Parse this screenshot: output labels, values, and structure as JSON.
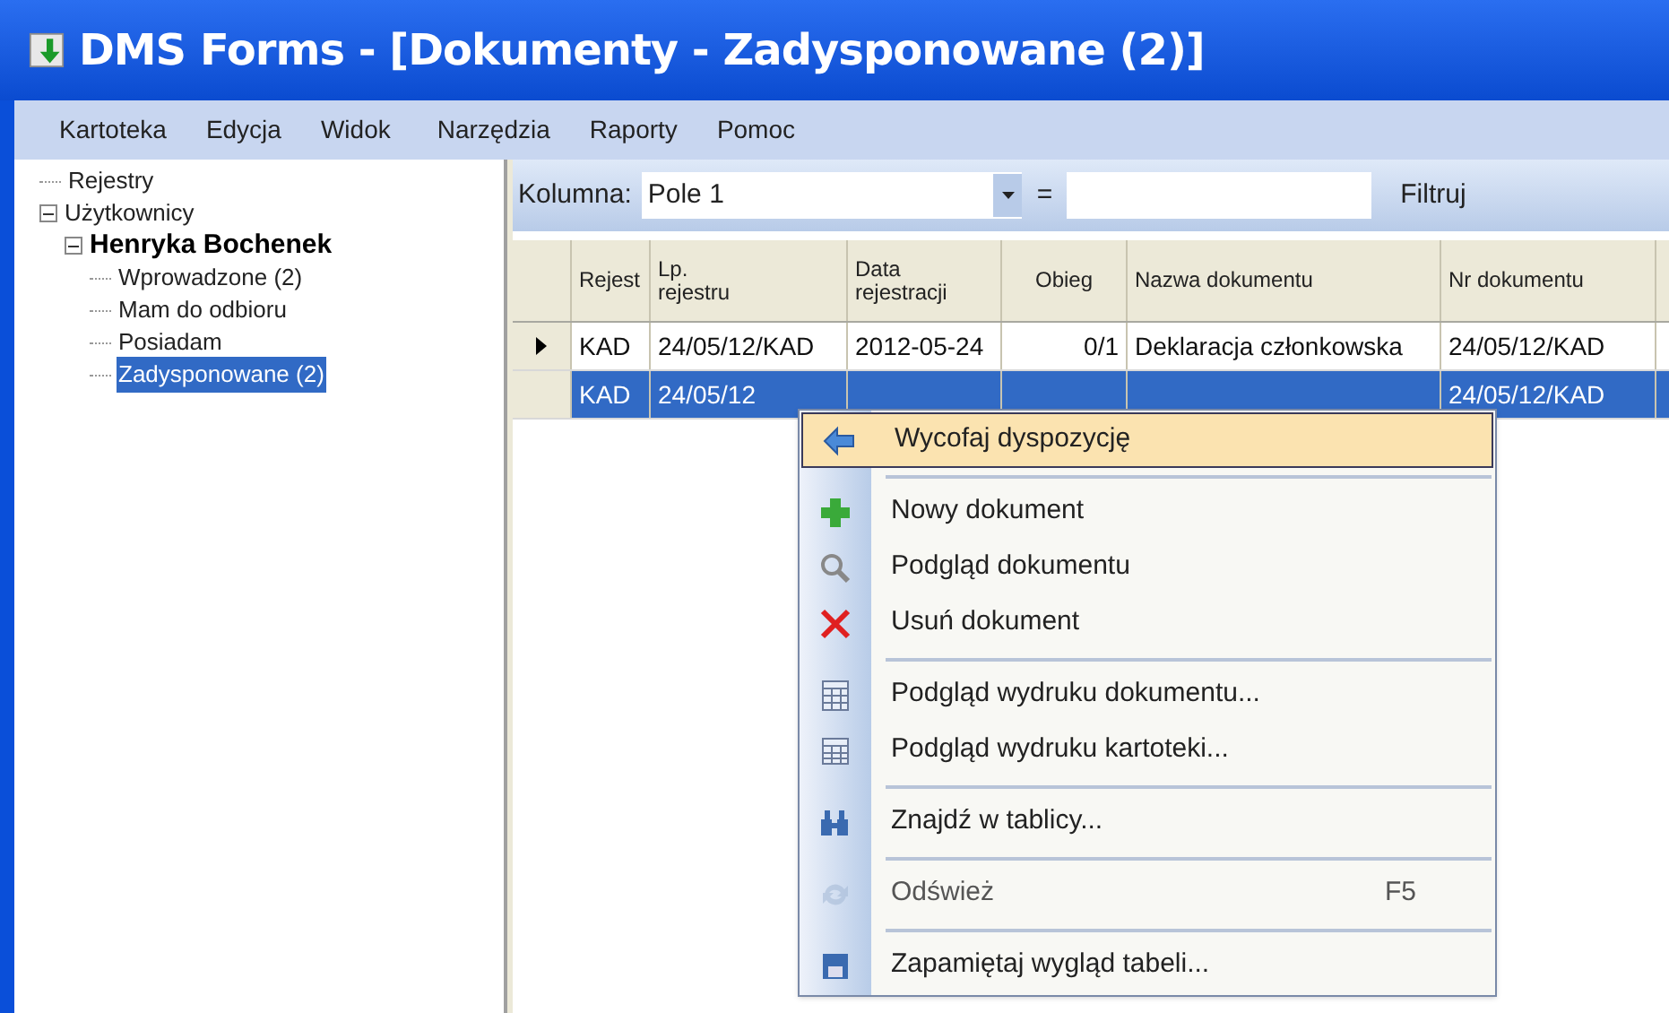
{
  "window": {
    "title": "DMS Forms - [Dokumenty - Zadysponowane (2)]"
  },
  "menu_bar": [
    "Kartoteka",
    "Edycja",
    "Widok",
    "Narzędzia",
    "Raporty",
    "Pomoc"
  ],
  "tree": [
    {
      "label": "Rejestry",
      "selected": false
    },
    {
      "label": "Użytkownicy",
      "expanded": true,
      "selected": false,
      "children": [
        {
          "label": "Henryka Bochenek",
          "expanded": true,
          "selected": false,
          "children": [
            {
              "label": "Wprowadzone (2)",
              "selected": false
            },
            {
              "label": "Mam do odbioru",
              "selected": false
            },
            {
              "label": "Posiadam",
              "selected": false
            },
            {
              "label": "Zadysponowane (2)",
              "selected": true
            }
          ]
        }
      ]
    }
  ],
  "filter": {
    "label": "Kolumna:",
    "column": "Pole 1",
    "operator": "=",
    "button": "Filtruj"
  },
  "table": {
    "columns": [
      "Rejest",
      "Lp.\nrejestru",
      "Data\nrejestracji",
      "Obieg",
      "Nazwa dokumentu",
      "Nr dokumentu"
    ],
    "rows": [
      {
        "current": true,
        "selected": false,
        "cells": [
          "KAD",
          "24/05/12/KAD",
          "2012-05-24",
          "0/1",
          "Deklaracja członkowska",
          "24/05/12/KAD"
        ]
      },
      {
        "current": false,
        "selected": true,
        "cells": [
          "KAD",
          "24/05/12",
          "",
          "",
          "",
          "24/05/12/KAD"
        ]
      }
    ]
  },
  "context_menu": [
    {
      "kind": "item",
      "label": "Wycofaj dyspozycję",
      "highlighted": true,
      "disabled": false
    },
    {
      "kind": "separator"
    },
    {
      "kind": "item",
      "label": "Nowy dokument",
      "highlighted": false,
      "disabled": false
    },
    {
      "kind": "item",
      "label": "Podgląd dokumentu",
      "highlighted": false,
      "disabled": false
    },
    {
      "kind": "item",
      "label": "Usuń dokument",
      "highlighted": false,
      "disabled": false
    },
    {
      "kind": "separator"
    },
    {
      "kind": "item",
      "label": "Podgląd wydruku dokumentu...",
      "highlighted": false,
      "disabled": false
    },
    {
      "kind": "item",
      "label": "Podgląd wydruku kartoteki...",
      "highlighted": false,
      "disabled": false
    },
    {
      "kind": "separator"
    },
    {
      "kind": "item",
      "label": "Znajdź w tablicy...",
      "highlighted": false,
      "disabled": false
    },
    {
      "kind": "separator"
    },
    {
      "kind": "item",
      "label": "Odśwież",
      "shortcut": "F5",
      "highlighted": false,
      "disabled": true
    },
    {
      "kind": "separator"
    },
    {
      "kind": "item",
      "label": "Zapamiętaj wygląd tabeli...",
      "highlighted": false,
      "disabled": false
    }
  ]
}
